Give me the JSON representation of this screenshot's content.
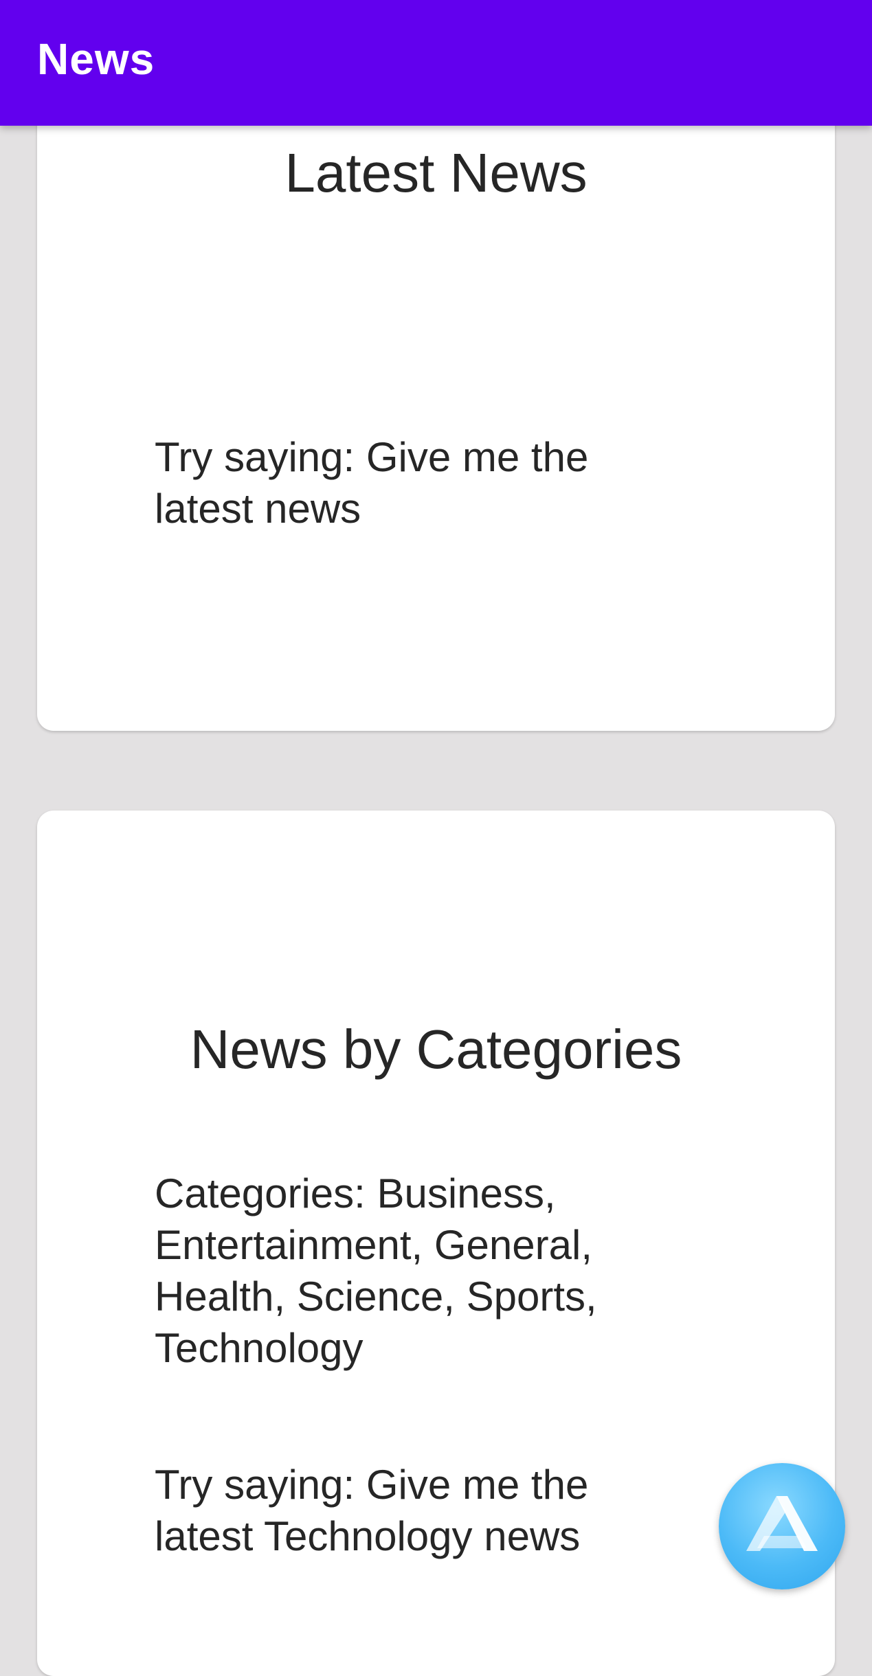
{
  "app_bar": {
    "title": "News",
    "background_color": "#6200ee"
  },
  "cards": {
    "latest": {
      "heading": "Latest News",
      "hint": "Try saying: Give me the latest news"
    },
    "categories": {
      "heading": "News by Categories",
      "categories_text": "Categories: Business, Entertainment, General, Health, Science, Sports, Technology",
      "hint": "Try saying: Give me the latest Technology news"
    }
  },
  "fab": {
    "icon": "alan-assistant-icon",
    "color": "#4cbaf7"
  }
}
